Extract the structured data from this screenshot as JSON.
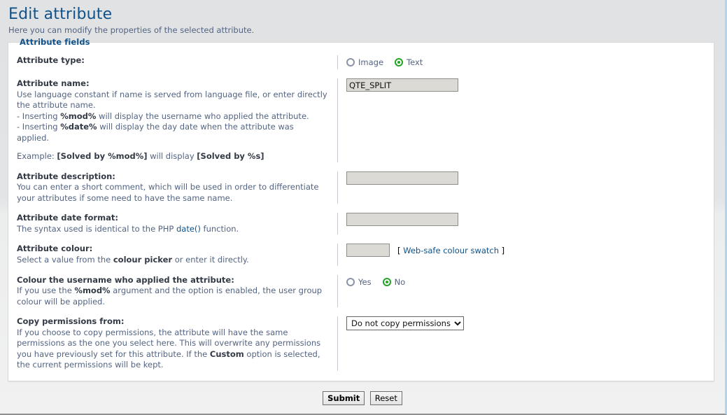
{
  "page": {
    "title": "Edit attribute",
    "subtitle": "Here you can modify the properties of the selected attribute."
  },
  "panel": {
    "legend": "Attribute fields"
  },
  "fields": {
    "attribute_type": {
      "label": "Attribute type:",
      "options": [
        {
          "label": "Image",
          "checked": false
        },
        {
          "label": "Text",
          "checked": true
        }
      ]
    },
    "attribute_name": {
      "label": "Attribute name:",
      "desc_line1": "Use language constant if name is served from language file, or enter directly the attribute name.",
      "desc_line2_prefix": "- Inserting ",
      "desc_line2_code": "%mod%",
      "desc_line2_suffix": " will display the username who applied the attribute.",
      "desc_line3_prefix": "- Inserting ",
      "desc_line3_code": "%date%",
      "desc_line3_suffix": " will display the day date when the attribute was applied.",
      "example_prefix": "Example: ",
      "example_input": "[Solved by %mod%]",
      "example_middle": " will display ",
      "example_output": "[Solved by %s]",
      "value": "QTE_SPLIT",
      "placeholder": ""
    },
    "attribute_description": {
      "label": "Attribute description:",
      "desc": "You can enter a short comment, which will be used in order to differentiate your attributes if some need to have the same name.",
      "value": "",
      "placeholder": ""
    },
    "attribute_date_format": {
      "label": "Attribute date format:",
      "desc_prefix": "The syntax used is identical to the PHP ",
      "desc_link": "date()",
      "desc_suffix": " function.",
      "value": "",
      "placeholder": ""
    },
    "attribute_colour": {
      "label": "Attribute colour:",
      "desc_prefix": "Select a value from the ",
      "desc_bold": "colour picker",
      "desc_suffix": " or enter it directly.",
      "value": "",
      "placeholder": "",
      "swatch_open_bracket": "[ ",
      "swatch_link": "Web-safe colour swatch",
      "swatch_close_bracket": " ]"
    },
    "colour_username": {
      "label": "Colour the username who applied the attribute:",
      "desc_prefix": "If you use the ",
      "desc_code": "%mod%",
      "desc_suffix": " argument and the option is enabled, the user group colour will be applied.",
      "options": [
        {
          "label": "Yes",
          "checked": false
        },
        {
          "label": "No",
          "checked": true
        }
      ]
    },
    "copy_permissions": {
      "label": "Copy permissions from:",
      "desc_prefix": "If you choose to copy permissions, the attribute will have the same permissions as the one you select here. This will overwrite any permissions you have previously set for this attribute. If the ",
      "desc_bold": "Custom",
      "desc_suffix": " option is selected, the current permissions will be kept.",
      "selected": "Do not copy permissions",
      "options": [
        "Do not copy permissions"
      ]
    }
  },
  "buttons": {
    "submit": "Submit",
    "reset": "Reset"
  },
  "colors": {
    "accent_blue": "#105289",
    "text_blue_grey": "#536482",
    "radio_checked_green": "#27a327",
    "input_fill": "#dcdad5",
    "page_bg": "#e9eaec"
  }
}
